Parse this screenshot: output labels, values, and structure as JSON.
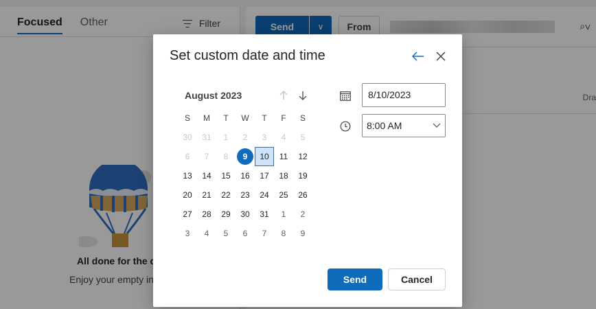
{
  "background": {
    "tabs": [
      {
        "label": "Focused",
        "active": true
      },
      {
        "label": "Other",
        "active": false
      }
    ],
    "filter_label": "Filter",
    "empty_title": "All done for the d",
    "empty_subtitle": "Enjoy your empty in",
    "toolbar": {
      "send_label": "Send",
      "from_label": "From"
    },
    "drafts_label": "Dra"
  },
  "dialog": {
    "title": "Set custom date and time",
    "calendar": {
      "month_label": "August 2023",
      "weekdays": [
        "S",
        "M",
        "T",
        "W",
        "T",
        "F",
        "S"
      ],
      "days": [
        {
          "label": "30",
          "state": "muted"
        },
        {
          "label": "31",
          "state": "muted"
        },
        {
          "label": "1",
          "state": "muted"
        },
        {
          "label": "2",
          "state": "muted"
        },
        {
          "label": "3",
          "state": "muted"
        },
        {
          "label": "4",
          "state": "muted"
        },
        {
          "label": "5",
          "state": "muted"
        },
        {
          "label": "6",
          "state": "muted"
        },
        {
          "label": "7",
          "state": "muted"
        },
        {
          "label": "8",
          "state": "muted"
        },
        {
          "label": "9",
          "state": "today"
        },
        {
          "label": "10",
          "state": "selected"
        },
        {
          "label": "11",
          "state": "normal"
        },
        {
          "label": "12",
          "state": "normal"
        },
        {
          "label": "13",
          "state": "normal"
        },
        {
          "label": "14",
          "state": "normal"
        },
        {
          "label": "15",
          "state": "normal"
        },
        {
          "label": "16",
          "state": "normal"
        },
        {
          "label": "17",
          "state": "normal"
        },
        {
          "label": "18",
          "state": "normal"
        },
        {
          "label": "19",
          "state": "normal"
        },
        {
          "label": "20",
          "state": "normal"
        },
        {
          "label": "21",
          "state": "normal"
        },
        {
          "label": "22",
          "state": "normal"
        },
        {
          "label": "23",
          "state": "normal"
        },
        {
          "label": "24",
          "state": "normal"
        },
        {
          "label": "25",
          "state": "normal"
        },
        {
          "label": "26",
          "state": "normal"
        },
        {
          "label": "27",
          "state": "normal"
        },
        {
          "label": "28",
          "state": "normal"
        },
        {
          "label": "29",
          "state": "normal"
        },
        {
          "label": "30",
          "state": "normal"
        },
        {
          "label": "31",
          "state": "normal"
        },
        {
          "label": "1",
          "state": "out"
        },
        {
          "label": "2",
          "state": "out"
        },
        {
          "label": "3",
          "state": "out"
        },
        {
          "label": "4",
          "state": "out"
        },
        {
          "label": "5",
          "state": "out"
        },
        {
          "label": "6",
          "state": "out"
        },
        {
          "label": "7",
          "state": "out"
        },
        {
          "label": "8",
          "state": "out"
        },
        {
          "label": "9",
          "state": "out"
        }
      ]
    },
    "date_value": "8/10/2023",
    "time_value": "8:00 AM",
    "send_label": "Send",
    "cancel_label": "Cancel"
  },
  "colors": {
    "accent": "#0f6cbd",
    "selected_day_bg": "#cfe4fa"
  }
}
